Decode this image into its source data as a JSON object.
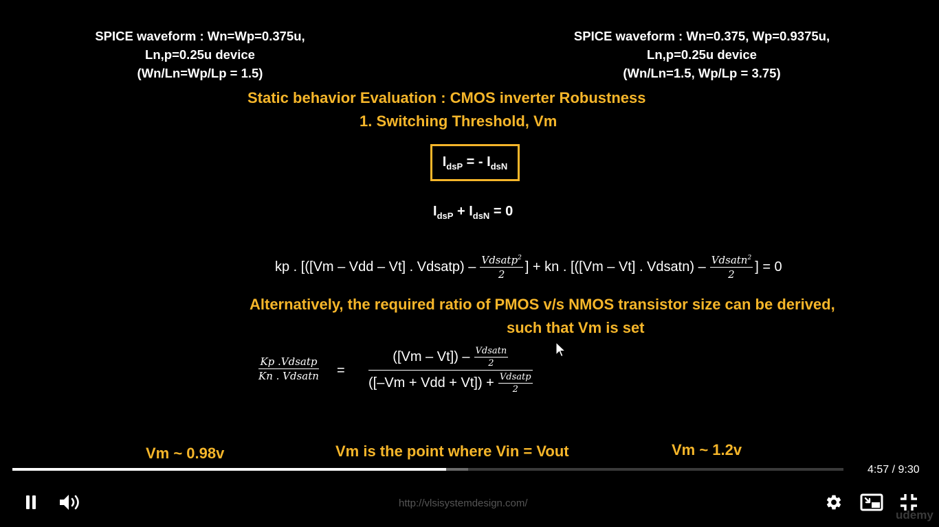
{
  "slide": {
    "left_caption": {
      "line1": "SPICE waveform : Wn=Wp=0.375u,",
      "line2": "Ln,p=0.25u device",
      "line3": "(Wn/Ln=Wp/Lp = 1.5)"
    },
    "right_caption": {
      "line1": "SPICE waveform : Wn=0.375, Wp=0.9375u,",
      "line2": "Ln,p=0.25u device",
      "line3": "(Wn/Ln=1.5, Wp/Lp = 3.75)"
    },
    "title_line1": "Static behavior Evaluation : CMOS inverter Robustness",
    "title_line2": "1. Switching Threshold, Vm",
    "boxed_equation": {
      "lhs": "I",
      "lhs_sub": "dsP",
      "mid": " = - I",
      "rhs_sub": "dsN"
    },
    "sum_equation": {
      "a": "I",
      "a_sub": "dsP",
      "b": " + I",
      "b_sub": "dsN",
      "c": " = 0"
    },
    "long_equation": {
      "part1": "kp . [([Vm – Vdd – Vt] . Vdsatp)  –",
      "frac1_num": "Vdsatp",
      "frac1_sup": "2",
      "frac1_den": "2",
      "part2": "] + kn . [([Vm – Vt] . Vdsatn)  –",
      "frac2_num": "Vdsatn",
      "frac2_sup": "2",
      "frac2_den": "2",
      "part3": "] = 0"
    },
    "alternative_line1": "Alternatively, the required ratio of PMOS v/s NMOS transistor size can be derived,",
    "alternative_line2": "such that Vm is set",
    "ratio_equation": {
      "lhs_num": "Kp .Vdsatp",
      "lhs_den": "Kn . Vdsatn",
      "equals": "=",
      "rhs_num_text": "([Vm – Vt])  –",
      "rhs_num_frac_num": "Vdsatn",
      "rhs_num_frac_den": "2",
      "rhs_den_text": "([–Vm + Vdd + Vt])  +",
      "rhs_den_frac_num": "Vdsatp",
      "rhs_den_frac_den": "2"
    },
    "vm_left": "Vm ~ 0.98v",
    "vm_center": "Vm is the point where Vin = Vout",
    "vm_right": "Vm ~ 1.2v",
    "watermark_url": "http://vlsisystemdesign.com/",
    "watermark_brand": "udemy"
  },
  "player": {
    "time_display": "4:57 / 9:30",
    "progress_played": 0.522,
    "progress_buffered": 0.548,
    "icons": {
      "pause": "pause-icon",
      "volume": "volume-icon",
      "settings": "gear-icon",
      "picture_in_picture": "picture-in-picture-icon",
      "exit_fullscreen": "exit-fullscreen-icon"
    }
  }
}
